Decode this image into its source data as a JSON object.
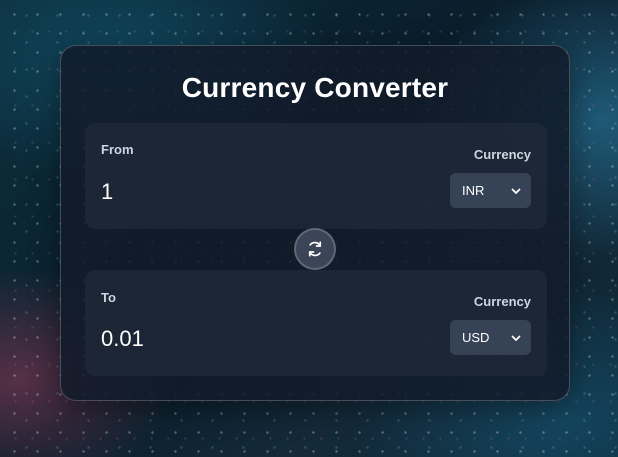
{
  "title": "Currency Converter",
  "from": {
    "label": "From",
    "amount": "1",
    "currency_label": "Currency",
    "currency": "INR"
  },
  "to": {
    "label": "To",
    "amount": "0.01",
    "currency_label": "Currency",
    "currency": "USD"
  },
  "icons": {
    "swap": "swap-arrows-icon",
    "dropdown": "chevron-down-icon"
  },
  "colors": {
    "card_background": "#121b2a",
    "panel_background": "#202a3a",
    "select_background": "#364256",
    "swap_button": "#3a4658",
    "text_primary": "#ffffff",
    "text_secondary": "#cdd5e0"
  }
}
